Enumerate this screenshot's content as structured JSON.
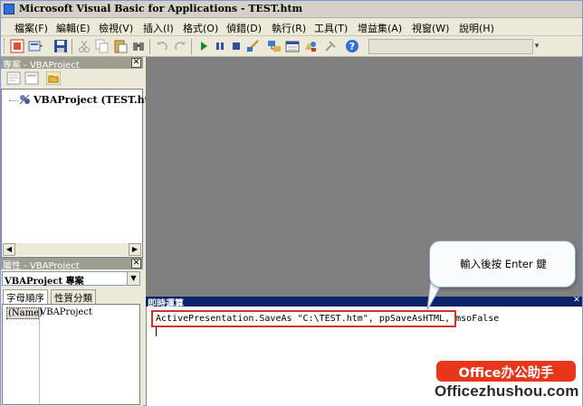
{
  "window": {
    "title": "Microsoft Visual Basic for Applications - TEST.htm"
  },
  "menu": [
    {
      "label": "檔案(F)"
    },
    {
      "label": "編輯(E)"
    },
    {
      "label": "檢視(V)"
    },
    {
      "label": "插入(I)"
    },
    {
      "label": "格式(O)"
    },
    {
      "label": "偵錯(D)"
    },
    {
      "label": "執行(R)"
    },
    {
      "label": "工具(T)"
    },
    {
      "label": "增益集(A)"
    },
    {
      "label": "視窗(W)"
    },
    {
      "label": "說明(H)"
    }
  ],
  "project_panel": {
    "title": "專案 - VBAProject",
    "close": "✕",
    "tree_item": "VBAProject (TEST.htm)"
  },
  "properties_panel": {
    "title": "屬性 - VBAProject",
    "close": "✕",
    "selected_object": "VBAProject 專案",
    "tabs": [
      {
        "label": "字母順序"
      },
      {
        "label": "性質分類"
      }
    ],
    "rows": [
      {
        "name": "(Name)",
        "value": "VBAProject"
      }
    ]
  },
  "immediate_window": {
    "title": "即時運算",
    "close": "✕",
    "line": "ActivePresentation.SaveAs \"C:\\TEST.htm\", ppSaveAsHTML, msoFalse"
  },
  "callout": {
    "text": "輸入後按 Enter 鍵"
  },
  "watermark": {
    "logo": "Office办公助手",
    "url": "Officezhushou.com"
  },
  "colors": {
    "mdi_background": "#808080",
    "immediate_title_bar": "#0a246a",
    "highlight": "#d0322c",
    "watermark_logo": "#e8361a"
  }
}
